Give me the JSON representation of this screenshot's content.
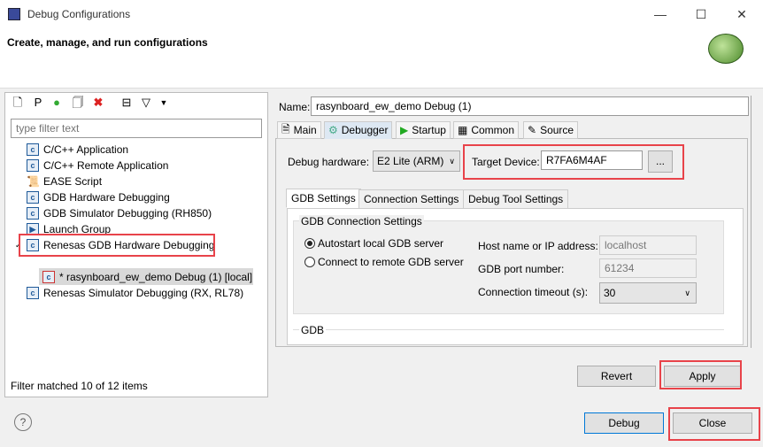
{
  "window": {
    "title": "Debug Configurations",
    "header": "Create, manage, and run configurations"
  },
  "left": {
    "filter_placeholder": "type filter text",
    "items": [
      "C/C++ Application",
      "C/C++ Remote Application",
      "EASE Script",
      "GDB Hardware Debugging",
      "GDB Simulator Debugging (RH850)",
      "Launch Group",
      "Renesas GDB Hardware Debugging",
      "* rasynboard_ew_demo Debug (1) [local]",
      "Renesas Simulator Debugging (RX, RL78)"
    ],
    "status": "Filter matched 10 of 12 items"
  },
  "right": {
    "name_label": "Name:",
    "name_value": "rasynboard_ew_demo Debug (1)",
    "tabs": [
      "Main",
      "Debugger",
      "Startup",
      "Common",
      "Source"
    ],
    "debug_hw_label": "Debug hardware:",
    "debug_hw_value": "E2 Lite (ARM)",
    "target_label": "Target Device:",
    "target_value": "R7FA6M4AF",
    "browse": "...",
    "subtabs": [
      "GDB Settings",
      "Connection Settings",
      "Debug Tool Settings"
    ],
    "group_title": "GDB Connection Settings",
    "radio_autostart": "Autostart local GDB server",
    "radio_remote": "Connect to remote GDB server",
    "host_label": "Host name or IP address:",
    "host_value": "localhost",
    "port_label": "GDB port number:",
    "port_value": "61234",
    "timeout_label": "Connection timeout (s):",
    "timeout_value": "30",
    "group2_title": "GDB",
    "revert": "Revert",
    "apply": "Apply"
  },
  "footer": {
    "help": "?",
    "debug": "Debug",
    "close": "Close"
  }
}
